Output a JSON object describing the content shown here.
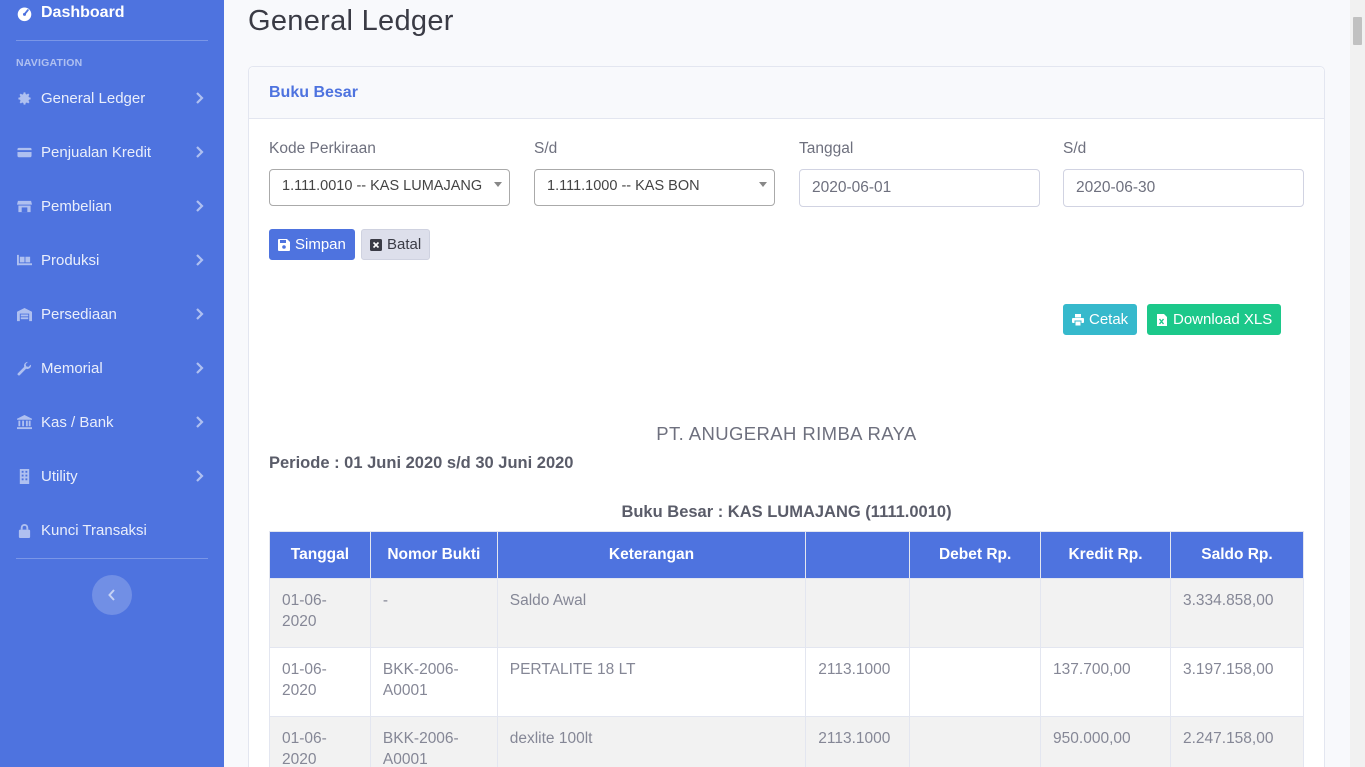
{
  "sidebar": {
    "brand": "Dashboard",
    "heading": "NAVIGATION",
    "items": [
      {
        "label": "General Ledger",
        "icon": "gear-icon"
      },
      {
        "label": "Penjualan Kredit",
        "icon": "credit-card-icon"
      },
      {
        "label": "Pembelian",
        "icon": "store-icon"
      },
      {
        "label": "Produksi",
        "icon": "pallet-icon"
      },
      {
        "label": "Persediaan",
        "icon": "warehouse-icon"
      },
      {
        "label": "Memorial",
        "icon": "wrench-icon"
      },
      {
        "label": "Kas / Bank",
        "icon": "bank-icon"
      },
      {
        "label": "Utility",
        "icon": "building-icon"
      },
      {
        "label": "Kunci Transaksi",
        "icon": "lock-icon"
      }
    ]
  },
  "page": {
    "title": "General Ledger"
  },
  "card": {
    "header": "Buku Besar"
  },
  "form": {
    "kode_label": "Kode Perkiraan",
    "kode_from": "1.111.0010 -- KAS LUMAJANG",
    "kode_to_label": "S/d",
    "kode_to": "1.111.1000 -- KAS BON",
    "tanggal_label": "Tanggal",
    "tanggal_from": "2020-06-01",
    "tanggal_to_label": "S/d",
    "tanggal_to": "2020-06-30",
    "save_label": "Simpan",
    "cancel_label": "Batal"
  },
  "actions": {
    "print_label": "Cetak",
    "download_label": "Download XLS"
  },
  "report": {
    "company": "PT. ANUGERAH RIMBA RAYA",
    "periode": "Periode : 01 Juni 2020 s/d 30 Juni 2020",
    "ledger_title": "Buku Besar : KAS LUMAJANG (1111.0010)",
    "columns": [
      "Tanggal",
      "Nomor Bukti",
      "Keterangan",
      "",
      "Debet Rp.",
      "Kredit Rp.",
      "Saldo Rp."
    ],
    "rows": [
      {
        "tanggal": "01-06-2020",
        "bukti": "-",
        "keterangan": "Saldo Awal",
        "akun": "",
        "debet": "",
        "kredit": "",
        "saldo": "3.334.858,00"
      },
      {
        "tanggal": "01-06-2020",
        "bukti": "BKK-2006-A0001",
        "keterangan": "PERTALITE 18 LT",
        "akun": "2113.1000",
        "debet": "",
        "kredit": "137.700,00",
        "saldo": "3.197.158,00"
      },
      {
        "tanggal": "01-06-2020",
        "bukti": "BKK-2006-A0001",
        "keterangan": "dexlite 100lt",
        "akun": "2113.1000",
        "debet": "",
        "kredit": "950.000,00",
        "saldo": "2.247.158,00"
      }
    ]
  },
  "colors": {
    "primary": "#4e73df",
    "info": "#36b9cc",
    "success": "#1cc88a",
    "secondary": "#dddfeb"
  }
}
